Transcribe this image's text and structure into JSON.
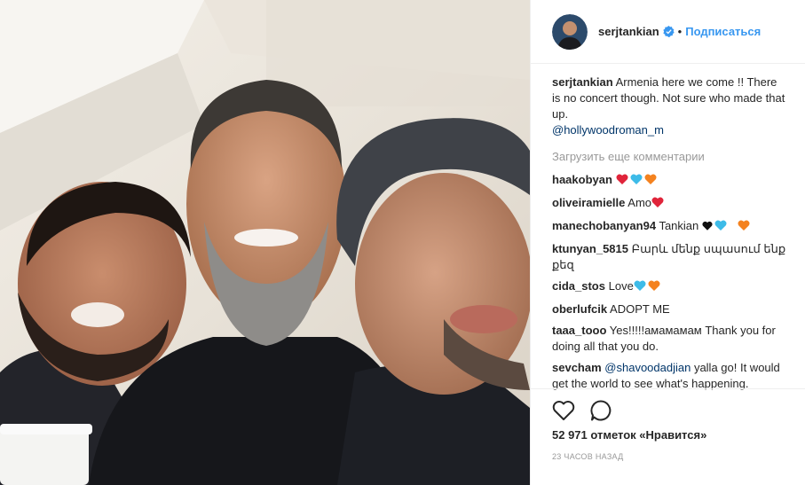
{
  "post": {
    "username": "serjtankian",
    "verified_icon": "verified-badge-icon",
    "separator": "•",
    "follow_label": "Подписаться",
    "caption_author": "serjtankian",
    "caption_text": "Armenia here we come !! There is no concert though. Not sure who made that up.",
    "caption_mention": "@hollywoodroman_m",
    "load_more": "Загрузить еще комментарии",
    "likes": "52 971 отметок «Нравится»",
    "time": "23 ЧАСОВ НАЗАД"
  },
  "comments": [
    {
      "author": "haakobyan",
      "text": ""
    },
    {
      "author": "oliveiramielle",
      "text": "Amo"
    },
    {
      "author": "manechobanyan94",
      "text": "Tankian"
    },
    {
      "author": "ktunyan_5815",
      "text": "Բարև մենք սպասում ենք քեզ"
    },
    {
      "author": "cida_stos",
      "text": "Love"
    },
    {
      "author": "oberlufcik",
      "text": "ADOPT ME"
    },
    {
      "author": "taaa_tooo",
      "text": "Yes!!!!!амамамам Thank you for doing all that you do."
    },
    {
      "author": "sevcham",
      "mention": "@shavoodadjian",
      "text": " yalla go! It would get the world to see what's happening."
    }
  ],
  "colors": {
    "accent": "#3897f0",
    "heart_red": "#e0243a",
    "heart_blue": "#3dbbe8",
    "heart_orange": "#f4821f",
    "heart_black": "#111111"
  },
  "icons": {
    "like": "heart-outline-icon",
    "comment": "comment-bubble-icon"
  }
}
